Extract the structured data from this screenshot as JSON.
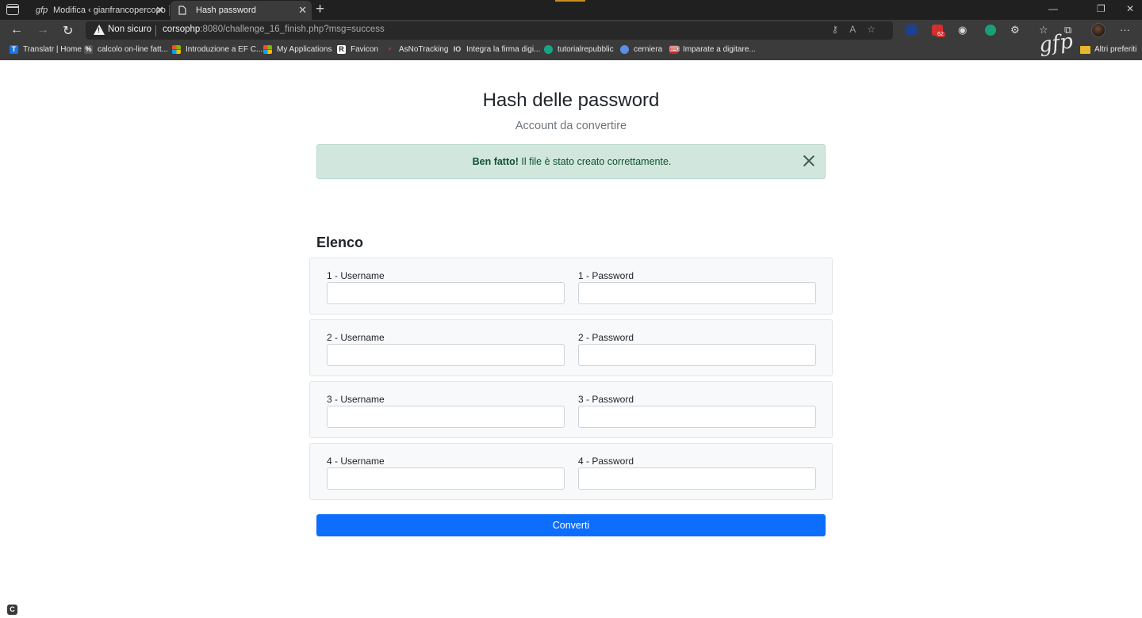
{
  "browser": {
    "tabs": [
      {
        "title": "Modifica ‹ gianfrancopercopo",
        "icon": "gfp-logo-icon"
      },
      {
        "title": "Hash password",
        "icon": "page-icon"
      }
    ],
    "address": {
      "security_label": "Non sicuro",
      "url_host": "corsophp",
      "url_rest": ":8080/challenge_16_finish.php?msg=success"
    },
    "extension_badge": "62",
    "bookmarks": [
      {
        "label": "Translatr | Home"
      },
      {
        "label": "calcolo on-line fatt..."
      },
      {
        "label": "Introduzione a EF C..."
      },
      {
        "label": "My Applications"
      },
      {
        "label": "Favicon"
      },
      {
        "label": "AsNoTracking"
      },
      {
        "label": "Integra la firma digi..."
      },
      {
        "label": "tutorialrepubblic"
      },
      {
        "label": "cerniera"
      },
      {
        "label": "Imparate a digitare..."
      }
    ],
    "other_favorites": "Altri preferiti"
  },
  "page": {
    "title": "Hash delle password",
    "subtitle": "Account da convertire",
    "alert": {
      "strong": "Ben fatto!",
      "message": " Il file è stato creato correttamente."
    },
    "section_title": "Elenco",
    "accounts": [
      {
        "username_label": "1 - Username",
        "password_label": "1 - Password"
      },
      {
        "username_label": "2 - Username",
        "password_label": "2 - Password"
      },
      {
        "username_label": "3 - Username",
        "password_label": "3 - Password"
      },
      {
        "username_label": "4 - Username",
        "password_label": "4 - Password"
      }
    ],
    "submit_label": "Converti"
  },
  "colors": {
    "primary": "#0d6efd",
    "alert_bg": "#d1e7dd",
    "alert_text": "#0f5132",
    "card_bg": "#f8f9fa"
  }
}
